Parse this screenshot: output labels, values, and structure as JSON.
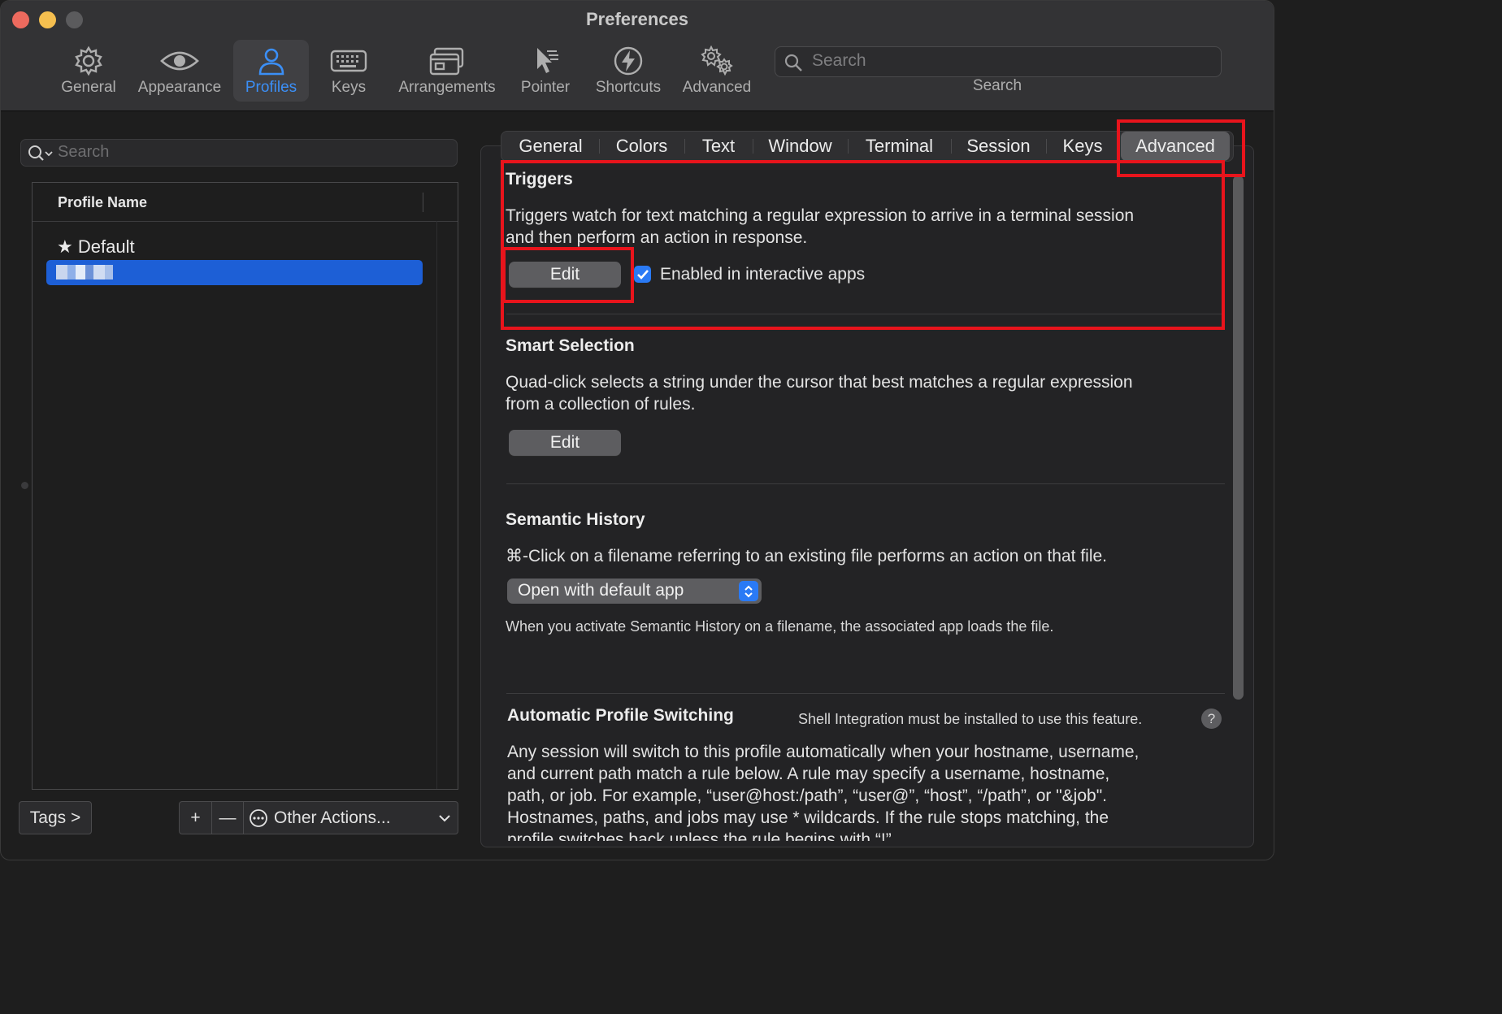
{
  "window": {
    "title": "Preferences"
  },
  "toolbar": {
    "items": [
      {
        "label": "General",
        "icon": "gear-icon"
      },
      {
        "label": "Appearance",
        "icon": "eye-icon"
      },
      {
        "label": "Profiles",
        "icon": "person-icon",
        "active": true
      },
      {
        "label": "Keys",
        "icon": "keyboard-icon"
      },
      {
        "label": "Arrangements",
        "icon": "window-arrangement-icon"
      },
      {
        "label": "Pointer",
        "icon": "pointer-icon"
      },
      {
        "label": "Shortcuts",
        "icon": "lightning-icon"
      },
      {
        "label": "Advanced",
        "icon": "gears-icon"
      }
    ],
    "search": {
      "placeholder": "Search",
      "caption": "Search"
    }
  },
  "profiles": {
    "search_placeholder": "Search",
    "column_header": "Profile Name",
    "rows": [
      {
        "name": "Default",
        "starred": true
      },
      {
        "name": "",
        "selected": true
      }
    ],
    "bottom": {
      "tags_label": "Tags >",
      "add_label": "+",
      "remove_label": "—",
      "other_actions_label": "Other Actions..."
    }
  },
  "tabs": [
    "General",
    "Colors",
    "Text",
    "Window",
    "Terminal",
    "Session",
    "Keys",
    "Advanced"
  ],
  "active_tab": "Advanced",
  "sections": {
    "triggers": {
      "title": "Triggers",
      "line1": "Triggers watch for text matching a regular expression to arrive in a terminal session",
      "line2": "and then perform an action in response.",
      "edit_label": "Edit",
      "checkbox_label": "Enabled in interactive apps",
      "checkbox_checked": true
    },
    "smart_selection": {
      "title": "Smart Selection",
      "line1": "Quad-click selects a string under the cursor that best matches a regular expression",
      "line2": "from a collection of rules.",
      "edit_label": "Edit"
    },
    "semantic_history": {
      "title": "Semantic History",
      "description": "⌘-Click on a filename referring to an existing file performs an action on that file.",
      "popup_value": "Open with default app",
      "note": "When you activate Semantic History on a filename, the associated app loads the file."
    },
    "auto_profile": {
      "title": "Automatic Profile Switching",
      "notice": "Shell Integration must be installed to use this feature.",
      "help_label": "?",
      "line1": "Any session will switch to this profile automatically when your hostname, username,",
      "line2": "and current path match a rule below. A rule may specify a username, hostname,",
      "line3": "path, or job. For example, “user@host:/path”, “user@”, “host”, “/path”, or \"&job\".",
      "line4": "Hostnames, paths, and jobs may use * wildcards. If the rule stops matching, the",
      "line5": "profile switches back unless the rule begins with “!”"
    }
  },
  "colors": {
    "accent": "#3b8ff7",
    "selection": "#1d5fd6",
    "annotation": "#e8141c"
  }
}
